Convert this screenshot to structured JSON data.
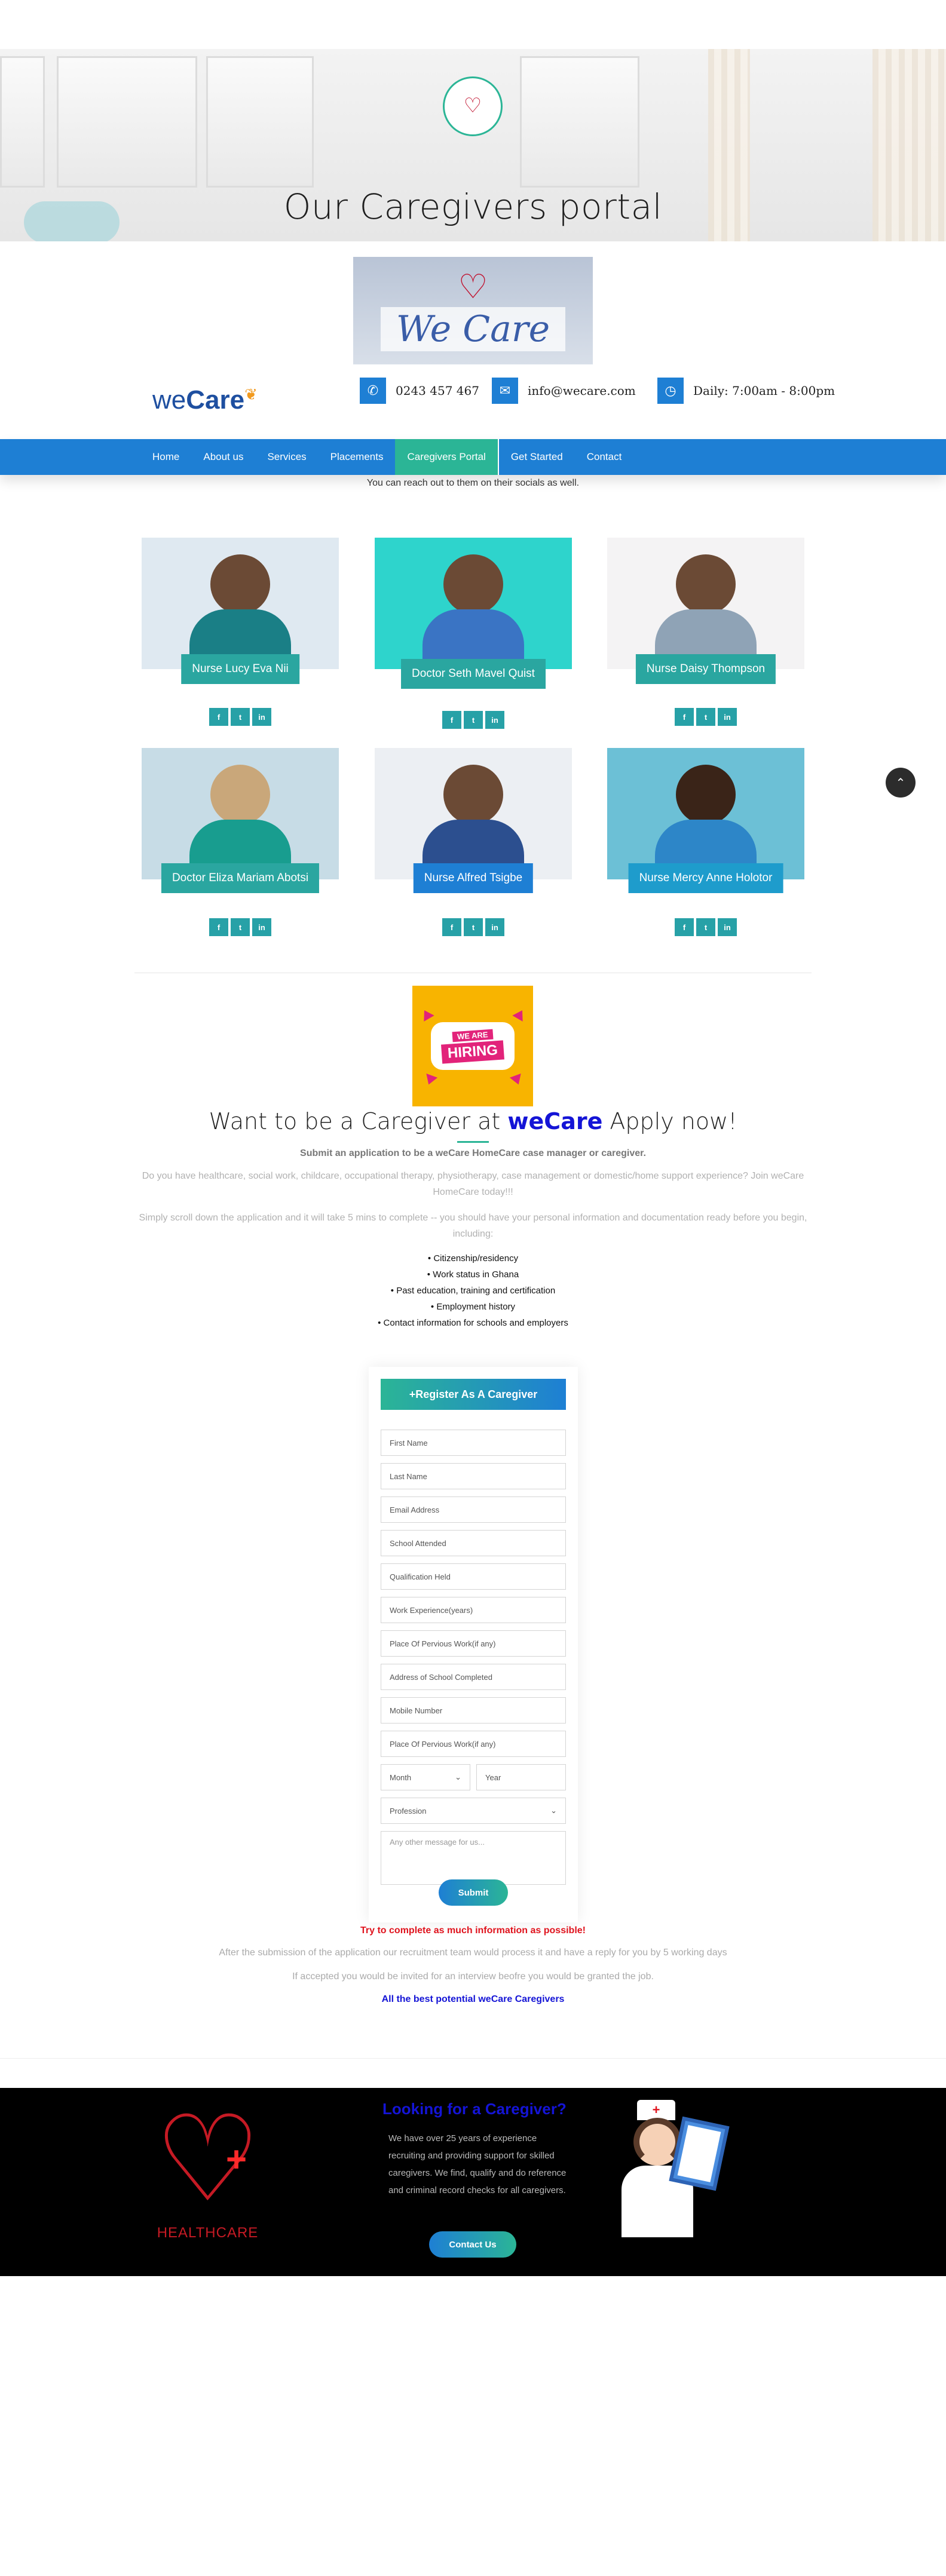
{
  "hero": {
    "title": "Our Caregivers portal",
    "logo_small_text": "",
    "colors": {
      "accent": "#2bb596",
      "brand_red": "#c0122f"
    }
  },
  "header": {
    "banner_script": "We Care",
    "brand_light": "we",
    "brand_bold": "Care",
    "contact": [
      {
        "icon": "phone-icon",
        "text": "0243 457 467"
      },
      {
        "icon": "mail-icon",
        "text": "info@wecare.com"
      },
      {
        "icon": "clock-icon",
        "text": "Daily: 7:00am - 8:00pm"
      }
    ]
  },
  "nav": {
    "items": [
      "Home",
      "About us",
      "Services",
      "Placements",
      "Caregivers Portal",
      "Get Started",
      "Contact"
    ],
    "active": "Caregivers Portal",
    "colors": {
      "bar": "#1e7fd4",
      "active": "#2bb596"
    }
  },
  "reach_text": "You can reach out to them on their socials as well.",
  "caregivers": [
    {
      "name": "Nurse Lucy Eva Nii",
      "bg": "#dfe9f1"
    },
    {
      "name": "Doctor Seth Mavel Quist",
      "bg": "#2ed4cc"
    },
    {
      "name": "Nurse Daisy Thompson",
      "bg": "#f4f3f4"
    },
    {
      "name": "Doctor Eliza Mariam Abotsi",
      "bg": "#c7dce6"
    },
    {
      "name": "Nurse Alfred Tsigbe",
      "bg": "#eceff3"
    },
    {
      "name": "Nurse Mercy Anne Holotor",
      "bg": "#6cc0d6"
    }
  ],
  "socials": [
    "f",
    "t",
    "in"
  ],
  "hiring": {
    "badge_top": "WE ARE",
    "badge_main": "HIRING"
  },
  "apply": {
    "title_pre": "Want to be a Caregiver at ",
    "title_brand": "weCare",
    "title_post": " Apply now!",
    "subtitle": "Submit an application to be a weCare HomeCare case manager or caregiver.",
    "para1": "Do you have healthcare, social work, childcare, occupational therapy, physiotherapy, case management or domestic/home support experience? Join weCare HomeCare today!!!",
    "para2": "Simply scroll down the application and it will take 5 mins to complete -- you should have your personal information and documentation ready before you begin, including:",
    "requirements": [
      "Citizenship/residency",
      "Work status in Ghana",
      "Past education, training and certification",
      "Employment history",
      "Contact information for schools and employers"
    ]
  },
  "form": {
    "header": "+Register As A Caregiver",
    "fields": [
      "First Name",
      "Last Name",
      "Email Address",
      "School Attended",
      "Qualification Held",
      "Work Experience(years)",
      "Place Of Pervious Work(if any)",
      "Address of School Completed",
      "Mobile Number",
      "Place Of Pervious Work(if any)"
    ],
    "month_select": "Month",
    "year_placeholder": "Year",
    "profession_select": "Profession",
    "message_placeholder": "Any other message for us...",
    "submit": "Submit"
  },
  "notes": {
    "warning": "Try to complete as much information as possible!",
    "after1": "After the submission of the application our recruitment team would process it and have a reply for you by 5 working days",
    "after2": "If accepted you would be invited for an interview beofre you would be granted the job.",
    "best": "All the best potential weCare Caregivers"
  },
  "footer": {
    "logo_text": "HEALTHCARE",
    "title": "Looking for a Caregiver?",
    "text": "We have over 25 years of experience recruiting and providing support for skilled caregivers. We find, qualify and do reference and criminal record checks for all caregivers.",
    "button": "Contact Us"
  }
}
